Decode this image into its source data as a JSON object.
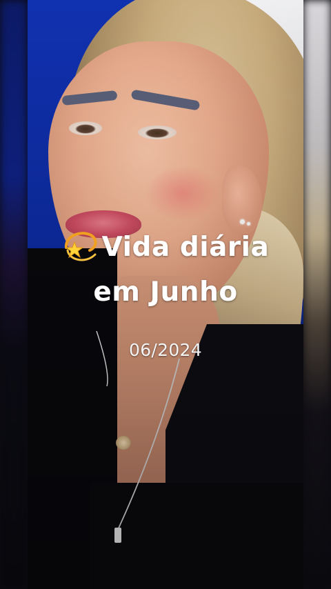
{
  "overlay": {
    "title_line1": "Vida diária",
    "title_line2": "em Junho",
    "date": "06/2024",
    "title_icon": "dizzy-star-emoji",
    "text_color": "#ffffff"
  },
  "photo": {
    "background_color": "#1031b0",
    "subject_top_color": "#0c0c10"
  }
}
